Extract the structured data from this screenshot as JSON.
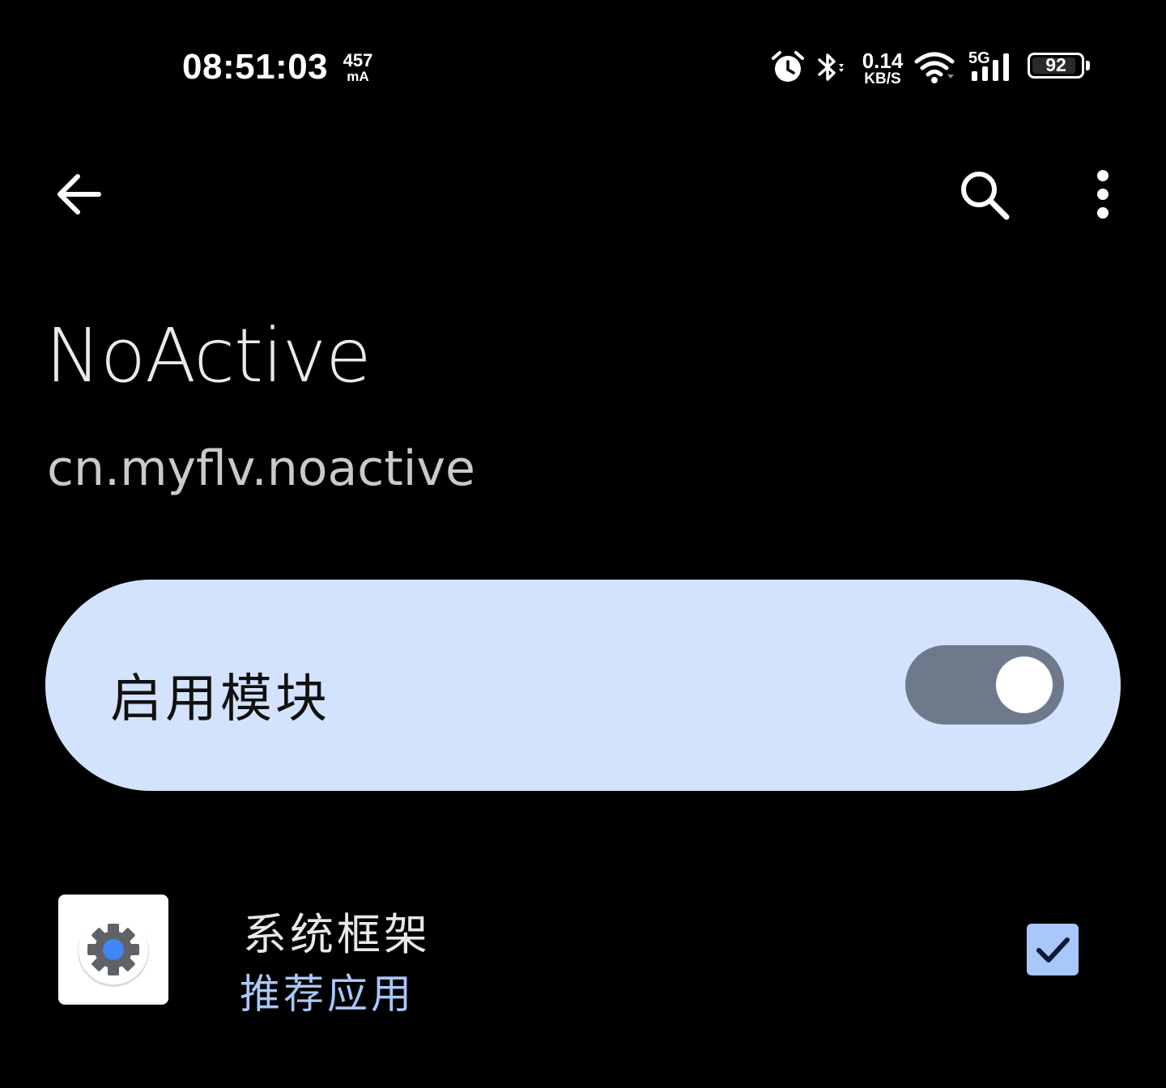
{
  "status_bar": {
    "time": "08:51:03",
    "current_value": "457",
    "current_unit": "mA",
    "net_speed_value": "0.14",
    "net_speed_unit": "KB/S",
    "network_type": "5G",
    "battery_percent": "92",
    "battery_level": 0.92,
    "icons": [
      "alarm-icon",
      "bluetooth-icon",
      "wifi-icon",
      "cellular-signal-icon",
      "battery-icon"
    ]
  },
  "app_bar": {
    "icons": [
      "back-arrow-icon",
      "search-icon",
      "more-vert-icon"
    ]
  },
  "header": {
    "title": "NoActive",
    "package": "cn.myflv.noactive"
  },
  "enable_card": {
    "label": "启用模块",
    "enabled": true,
    "background": "#d3e3fd",
    "switch_track": "#6e7a8c"
  },
  "scope_list": {
    "items": [
      {
        "name": "系统框架",
        "tag": "推荐应用",
        "icon": "settings-gear-icon",
        "checked": true
      }
    ]
  },
  "colors": {
    "background": "#000000",
    "accent": "#a8c7fa"
  }
}
